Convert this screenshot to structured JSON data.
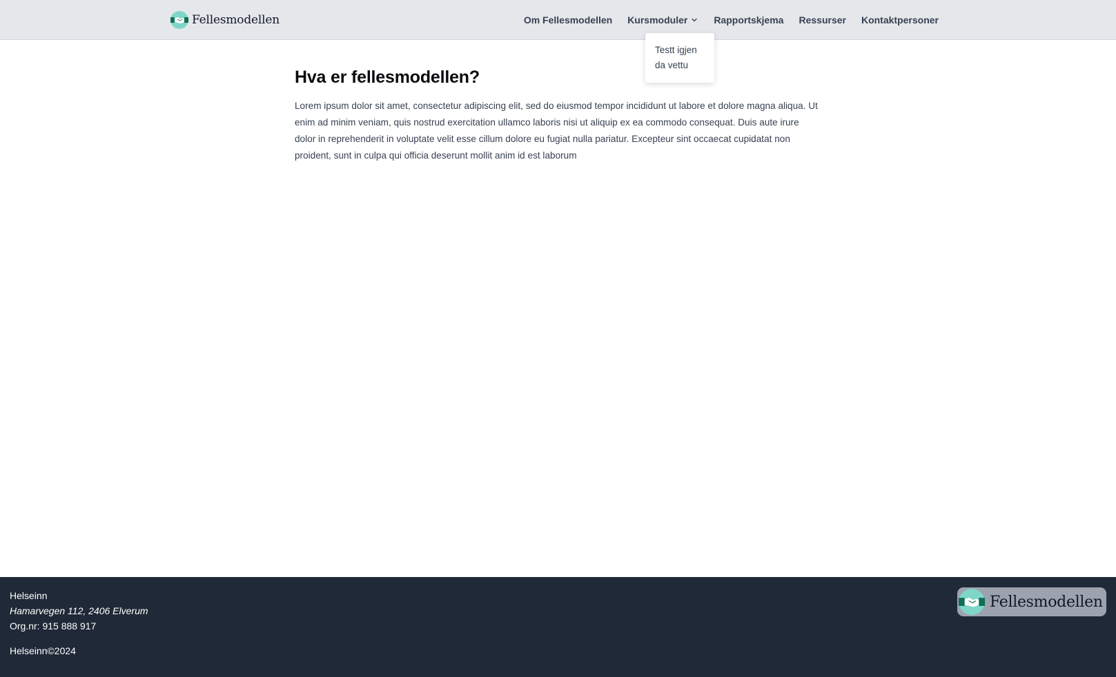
{
  "brand": {
    "name": "Fellesmodellen",
    "logo_icon": "handshake-logo-icon",
    "colors": {
      "circle": "#7fd6c8",
      "band": "#0f6e55"
    }
  },
  "nav": {
    "items": [
      {
        "label": "Om Fellesmodellen"
      },
      {
        "label": "Kursmoduler",
        "has_dropdown": true,
        "icon": "chevron-down-icon"
      },
      {
        "label": "Rapportskjema"
      },
      {
        "label": "Ressurser"
      },
      {
        "label": "Kontaktpersoner"
      }
    ],
    "dropdown": {
      "items": [
        "Testt igjen",
        "da vettu"
      ]
    }
  },
  "main": {
    "title": "Hva er fellesmodellen?",
    "text": "Lorem ipsum dolor sit amet, consectetur adipiscing elit, sed do eiusmod tempor incididunt ut labore et dolore magna aliqua. Ut enim ad minim veniam, quis nostrud exercitation ullamco laboris nisi ut aliquip ex ea commodo consequat. Duis aute irure dolor in reprehenderit in voluptate velit esse cillum dolore eu fugiat nulla pariatur. Excepteur sint occaecat cupidatat non proident, sunt in culpa qui officia deserunt mollit anim id est laborum"
  },
  "footer": {
    "company": "Helseinn",
    "address": "Hamarvegen 112, 2406 Elverum",
    "org_nr": "Org.nr: 915 888 917",
    "copyright": "Helseinn©2024",
    "logo_text": "Fellesmodellen",
    "background": "#1f2937"
  }
}
